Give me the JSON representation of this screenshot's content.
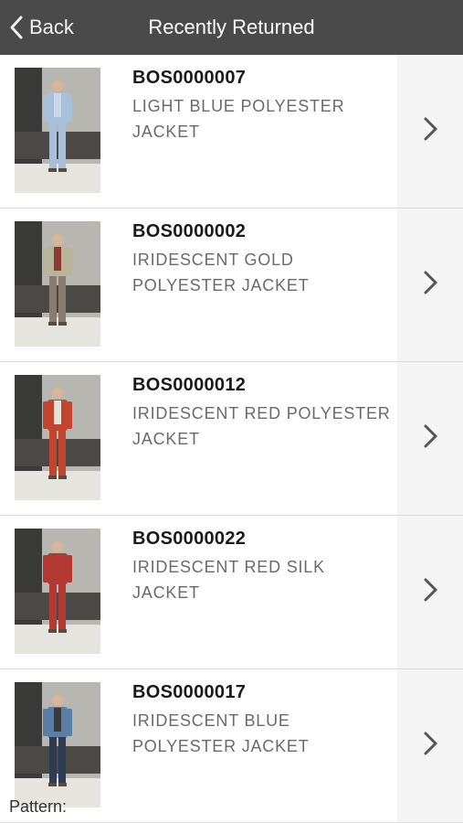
{
  "nav": {
    "back_label": "Back",
    "title": "Recently Returned"
  },
  "items": [
    {
      "sku": "BOS0000007",
      "description": "LIGHT BLUE POLYESTER JACKET",
      "jacket_color": "#a7bfd8",
      "pants_color": "#a7bfd8",
      "shirt_color": "#c8d8e8"
    },
    {
      "sku": "BOS0000002",
      "description": "IRIDESCENT GOLD POLYESTER JACKET",
      "jacket_color": "#b9b39c",
      "pants_color": "#8a7d6e",
      "shirt_color": "#8a3a2e"
    },
    {
      "sku": "BOS0000012",
      "description": "IRIDESCENT RED POLYESTER JACKET",
      "jacket_color": "#c2452e",
      "pants_color": "#c2452e",
      "shirt_color": "#e8e2dc"
    },
    {
      "sku": "BOS0000022",
      "description": "IRIDESCENT RED SILK JACKET",
      "jacket_color": "#b23a33",
      "pants_color": "#b23a33",
      "shirt_color": "#b23a33"
    },
    {
      "sku": "BOS0000017",
      "description": "IRIDESCENT BLUE POLYESTER JACKET",
      "jacket_color": "#5a7ea6",
      "pants_color": "#2e3b55",
      "shirt_color": "#3a3a3a"
    }
  ],
  "footer_fragment": "Pattern:",
  "colors": {
    "navbar": "#4a4a4a",
    "chevron": "#555555",
    "divider": "#dcdcdc"
  }
}
